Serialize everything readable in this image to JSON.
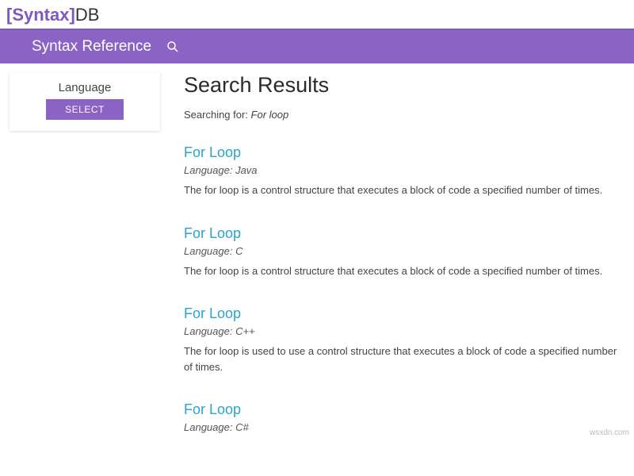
{
  "logo": {
    "b1": "[",
    "syntax": "Syntax",
    "b2": "]",
    "db": "DB"
  },
  "nav": {
    "title": "Syntax Reference"
  },
  "sidebar": {
    "title": "Language",
    "select_label": "SELECT"
  },
  "main": {
    "title": "Search Results",
    "searching_prefix": "Searching for: ",
    "searching_term": "For loop"
  },
  "results": [
    {
      "title": "For Loop",
      "lang_prefix": "Language: ",
      "lang": "Java",
      "desc": "The for loop is a control structure that executes a block of code a specified number of times."
    },
    {
      "title": "For Loop",
      "lang_prefix": "Language: ",
      "lang": "C",
      "desc": "The for loop is a control structure that executes a block of code a specified number of times."
    },
    {
      "title": "For Loop",
      "lang_prefix": "Language: ",
      "lang": "C++",
      "desc": "The for loop is used to use a control structure that executes a block of code a specified number of times."
    },
    {
      "title": "For Loop",
      "lang_prefix": "Language: ",
      "lang": "C#",
      "desc": ""
    }
  ],
  "watermark": "wsxdn.com"
}
